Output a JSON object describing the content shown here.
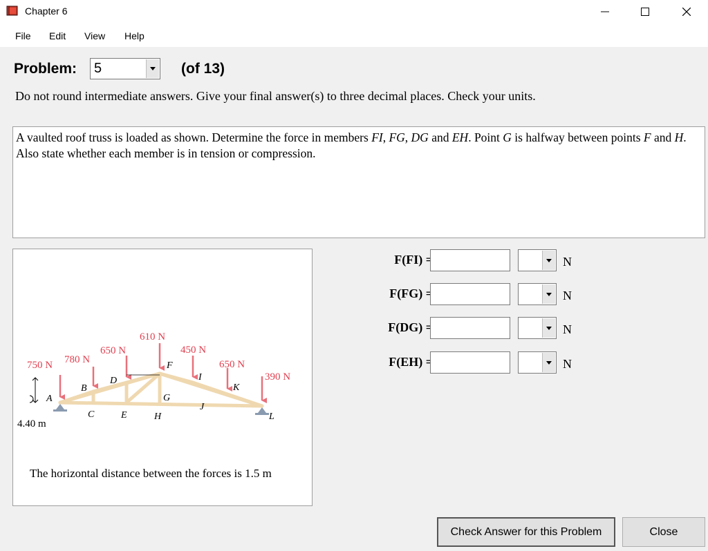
{
  "window": {
    "title": "Chapter 6"
  },
  "menu": [
    "File",
    "Edit",
    "View",
    "Help"
  ],
  "problem": {
    "label": "Problem:",
    "selected": "5",
    "of_text": "(of 13)"
  },
  "instructions": "Do not round intermediate answers.  Give your final answer(s) to three decimal places.  Check your units.",
  "problem_text": {
    "t1": "A vaulted roof truss is loaded as shown. Determine the force in members ",
    "m1": "FI",
    "c1": ", ",
    "m2": "FG",
    "c2": ", ",
    "m3": "DG",
    "t2": " and ",
    "m4": "EH",
    "t3": ".  Point ",
    "m5": "G",
    "t4": " is halfway between points ",
    "m6": "F",
    "t5": " and ",
    "m7": "H",
    "t6": ".  Also state whether each member is in tension or compression."
  },
  "figure": {
    "loads": [
      "750 N",
      "780 N",
      "650 N",
      "610 N",
      "450 N",
      "650 N",
      "390 N"
    ],
    "points": [
      "A",
      "B",
      "C",
      "D",
      "E",
      "F",
      "G",
      "H",
      "I",
      "J",
      "K",
      "L"
    ],
    "dimension": "4.40 m",
    "caption": "The horizontal distance between the forces is 1.5 m"
  },
  "answers": [
    {
      "label": "F(FI) =",
      "value": "",
      "unit": "N"
    },
    {
      "label": "F(FG) =",
      "value": "",
      "unit": "N"
    },
    {
      "label": "F(DG) =",
      "value": "",
      "unit": "N"
    },
    {
      "label": "F(EH) =",
      "value": "",
      "unit": "N"
    }
  ],
  "buttons": {
    "check": "Check Answer for this Problem",
    "close": "Close"
  },
  "colors": {
    "load_arrow": "#e8707a",
    "truss": "#efd8b0"
  }
}
